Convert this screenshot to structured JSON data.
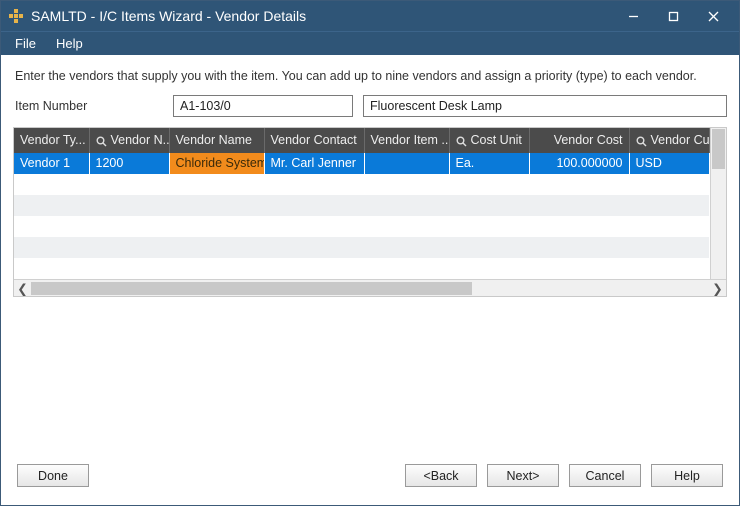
{
  "window": {
    "title": "SAMLTD - I/C Items Wizard - Vendor Details"
  },
  "menu": {
    "file": "File",
    "help": "Help"
  },
  "intro": "Enter the vendors that supply you with the item. You can add up to nine vendors and assign a priority (type) to each vendor.",
  "item": {
    "label": "Item Number",
    "number": "A1-103/0",
    "description": "Fluorescent Desk Lamp"
  },
  "grid": {
    "headers": {
      "vendor_type": "Vendor Ty...",
      "vendor_num": "Vendor N...",
      "vendor_name": "Vendor Name",
      "vendor_contact": "Vendor Contact",
      "vendor_item": "Vendor Item ...",
      "cost_unit": "Cost Unit",
      "vendor_cost": "Vendor Cost",
      "vendor_curr": "Vendor Cu..."
    },
    "rows": [
      {
        "vendor_type": "Vendor 1",
        "vendor_num": "1200",
        "vendor_name": "Chloride Systems",
        "vendor_contact": "Mr. Carl Jenner",
        "vendor_item": "",
        "cost_unit": "Ea.",
        "vendor_cost": "100.000000",
        "vendor_curr": "USD"
      }
    ]
  },
  "buttons": {
    "done": "Done",
    "back": "<Back",
    "next": "Next>",
    "cancel": "Cancel",
    "help": "Help"
  }
}
